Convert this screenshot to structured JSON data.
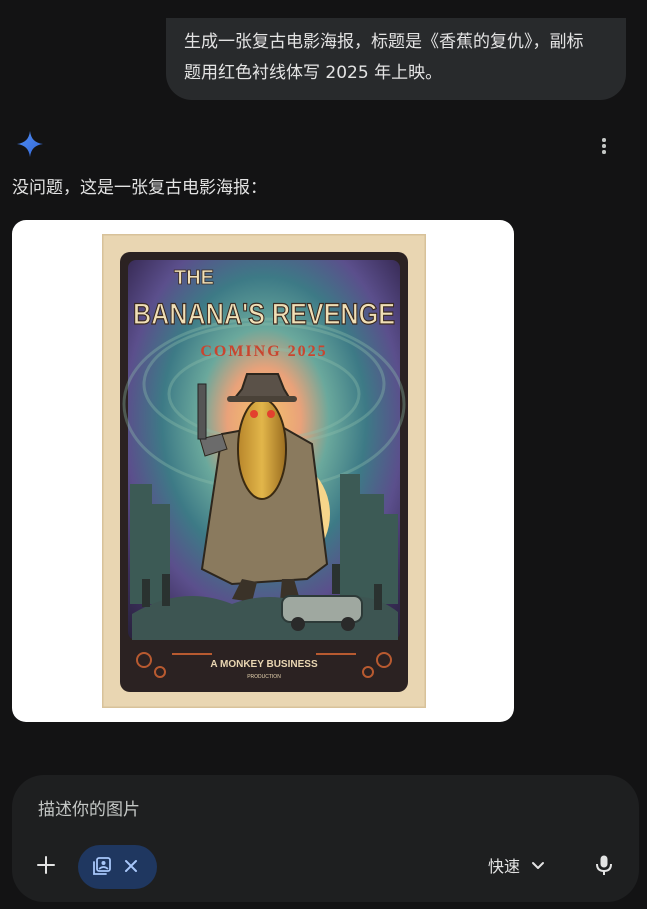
{
  "conversation": {
    "user_message_line1": "生成一张复古电影海报，标题是《香蕉的复仇》，副标",
    "user_message_line2": "题用红色衬线体写 2025 年上映。",
    "reply_text": "没问题，这是一张复古电影海报："
  },
  "poster": {
    "title_small": "THE",
    "title_main": "BANANA'S REVENGE",
    "subtitle": "COMING 2025",
    "credit_main": "A MONKEY BUSINESS",
    "credit_sub": "PRODUCTION"
  },
  "composer": {
    "placeholder": "描述你的图片",
    "model_label": "快速"
  },
  "icons": {
    "assistant": "gemini-sparkle-icon",
    "more": "more-vertical-icon",
    "add": "plus-icon",
    "image_tool": "image-tool-icon",
    "close": "close-icon",
    "dropdown": "chevron-down-icon",
    "microphone": "microphone-icon"
  },
  "colors": {
    "background": "#131314",
    "bubble": "#282a2c",
    "input_box": "#1e1f20",
    "chip": "#1f3760",
    "accent": "#4285f4",
    "poster_subtitle": "#c9452f"
  }
}
